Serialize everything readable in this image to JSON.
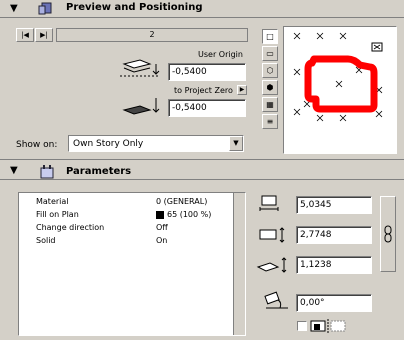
{
  "preview": {
    "title": "Preview and Positioning",
    "story_value": "2",
    "user_origin_label": "User Origin",
    "user_origin_value": "-0,5400",
    "to_project_zero_label": "to Project Zero",
    "project_zero_value": "-0,5400",
    "show_on_label": "Show on:",
    "show_on_value": "Own Story Only"
  },
  "parameters": {
    "title": "Parameters",
    "rows": [
      {
        "key": "Material",
        "value": "0 (GENERAL)"
      },
      {
        "key": "Fill on Plan",
        "value": "65 (100 %)"
      },
      {
        "key": "Change direction",
        "value": "Off"
      },
      {
        "key": "Solid",
        "value": "On"
      }
    ],
    "width_value": "5,0345",
    "depth_value": "2,7748",
    "height_value": "1,1238",
    "angle_value": "0,00°"
  },
  "colors": {
    "bg": "#d4d0c8",
    "preview_shape": "#ff0000"
  }
}
